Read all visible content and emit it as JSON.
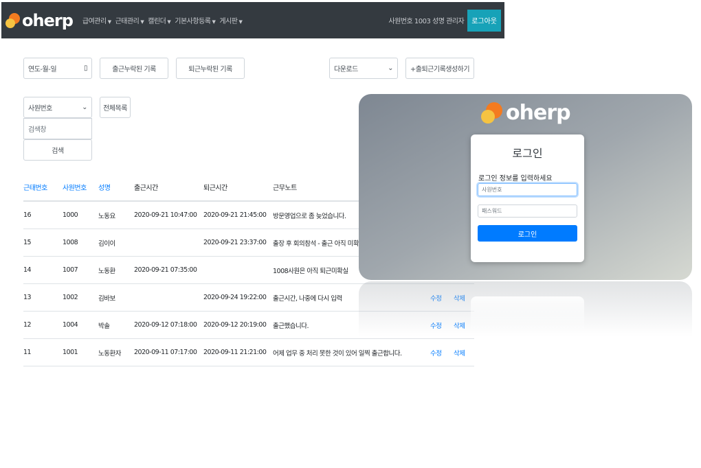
{
  "navbar": {
    "brand": "oherp",
    "menu": [
      {
        "label": "급여관리"
      },
      {
        "label": "근태관리"
      },
      {
        "label": "캘린더"
      },
      {
        "label": "기본사항등록"
      },
      {
        "label": "게시판"
      }
    ],
    "user_info": "사원번호 1003 성명 관리자",
    "logout_label": "로그아웃"
  },
  "filters": {
    "date_placeholder": "연도-월-일",
    "missing_in_label": "출근누락된 기록",
    "missing_out_label": "퇴근누락된 기록",
    "download_select": "다운로드",
    "create_label": "+출퇴근기록생성하기",
    "search_select": "사원번호",
    "all_list_label": "전체목록",
    "search_placeholder": "검색창",
    "search_button": "검색"
  },
  "table": {
    "headers": [
      "근태번호",
      "사원번호",
      "성명",
      "출근시간",
      "퇴근시간",
      "근무노트"
    ],
    "rows": [
      {
        "id": "16",
        "emp": "1000",
        "name": "노동요",
        "in": "2020-09-21 10:47:00",
        "out": "2020-09-21 21:45:00",
        "note": "방문영업으로 좀 늦었습니다.",
        "edit": "",
        "delete": ""
      },
      {
        "id": "15",
        "emp": "1008",
        "name": "김이이",
        "in": "",
        "out": "2020-09-21 23:37:00",
        "note": "출장 후 회의참석 - 출근 아직 미확실",
        "edit": "",
        "delete": ""
      },
      {
        "id": "14",
        "emp": "1007",
        "name": "노동환",
        "in": "2020-09-21 07:35:00",
        "out": "",
        "note": "1008사원은 아직 퇴근미확실",
        "edit": "",
        "delete": ""
      },
      {
        "id": "13",
        "emp": "1002",
        "name": "김바보",
        "in": "",
        "out": "2020-09-24 19:22:00",
        "note": "출근시간, 나중에 다시 입력",
        "edit": "수정",
        "delete": "삭제"
      },
      {
        "id": "12",
        "emp": "1004",
        "name": "박솔",
        "in": "2020-09-12 07:18:00",
        "out": "2020-09-12 20:19:00",
        "note": "출근했습니다.",
        "edit": "수정",
        "delete": "삭제"
      },
      {
        "id": "11",
        "emp": "1001",
        "name": "노동환자",
        "in": "2020-09-11 07:17:00",
        "out": "2020-09-11 21:21:00",
        "note": "어제 업무 중 처리 못한 것이 있어 일찍 출근합니다.",
        "edit": "수정",
        "delete": "삭제"
      }
    ]
  },
  "login": {
    "brand": "oherp",
    "title": "로그인",
    "subtitle": "로그인 정보를 입력하세요",
    "id_placeholder": "사원번호",
    "pw_placeholder": "패스워드",
    "button": "로그인"
  },
  "colors": {
    "navbar": "#343a40",
    "accent": "#007bff",
    "logout": "#17a2b8",
    "logo_orange": "#f47b20",
    "logo_yellow": "#f5c342"
  }
}
